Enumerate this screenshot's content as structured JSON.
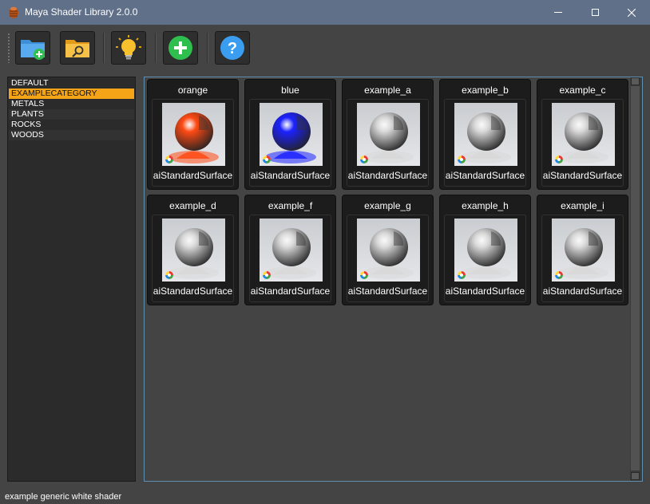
{
  "window": {
    "title": "Maya Shader Library 2.0.0"
  },
  "toolbar": {
    "buttons": [
      {
        "name": "add-folder-icon"
      },
      {
        "name": "search-folder-icon"
      },
      {
        "name": "lightbulb-icon"
      },
      {
        "name": "plus-icon"
      },
      {
        "name": "help-icon"
      }
    ]
  },
  "categories": [
    "DEFAULT",
    "EXAMPLECATEGORY",
    "METALS",
    "PLANTS",
    "ROCKS",
    "WOODS"
  ],
  "selected_category": "EXAMPLECATEGORY",
  "shaders": [
    {
      "name": "orange",
      "type": "aiStandardSurface",
      "color": "#ff4a14"
    },
    {
      "name": "blue",
      "type": "aiStandardSurface",
      "color": "#1c22ff"
    },
    {
      "name": "example_a",
      "type": "aiStandardSurface",
      "color": "#d8d8d8"
    },
    {
      "name": "example_b",
      "type": "aiStandardSurface",
      "color": "#d8d8d8"
    },
    {
      "name": "example_c",
      "type": "aiStandardSurface",
      "color": "#d8d8d8"
    },
    {
      "name": "example_d",
      "type": "aiStandardSurface",
      "color": "#d8d8d8"
    },
    {
      "name": "example_f",
      "type": "aiStandardSurface",
      "color": "#d8d8d8"
    },
    {
      "name": "example_g",
      "type": "aiStandardSurface",
      "color": "#d8d8d8"
    },
    {
      "name": "example_h",
      "type": "aiStandardSurface",
      "color": "#d8d8d8"
    },
    {
      "name": "example_i",
      "type": "aiStandardSurface",
      "color": "#d8d8d8"
    }
  ],
  "status_text": "example generic white shader",
  "colors": {
    "selection": "#f6a417",
    "titlebar": "#607089",
    "panel_border": "#5f8fb0"
  }
}
